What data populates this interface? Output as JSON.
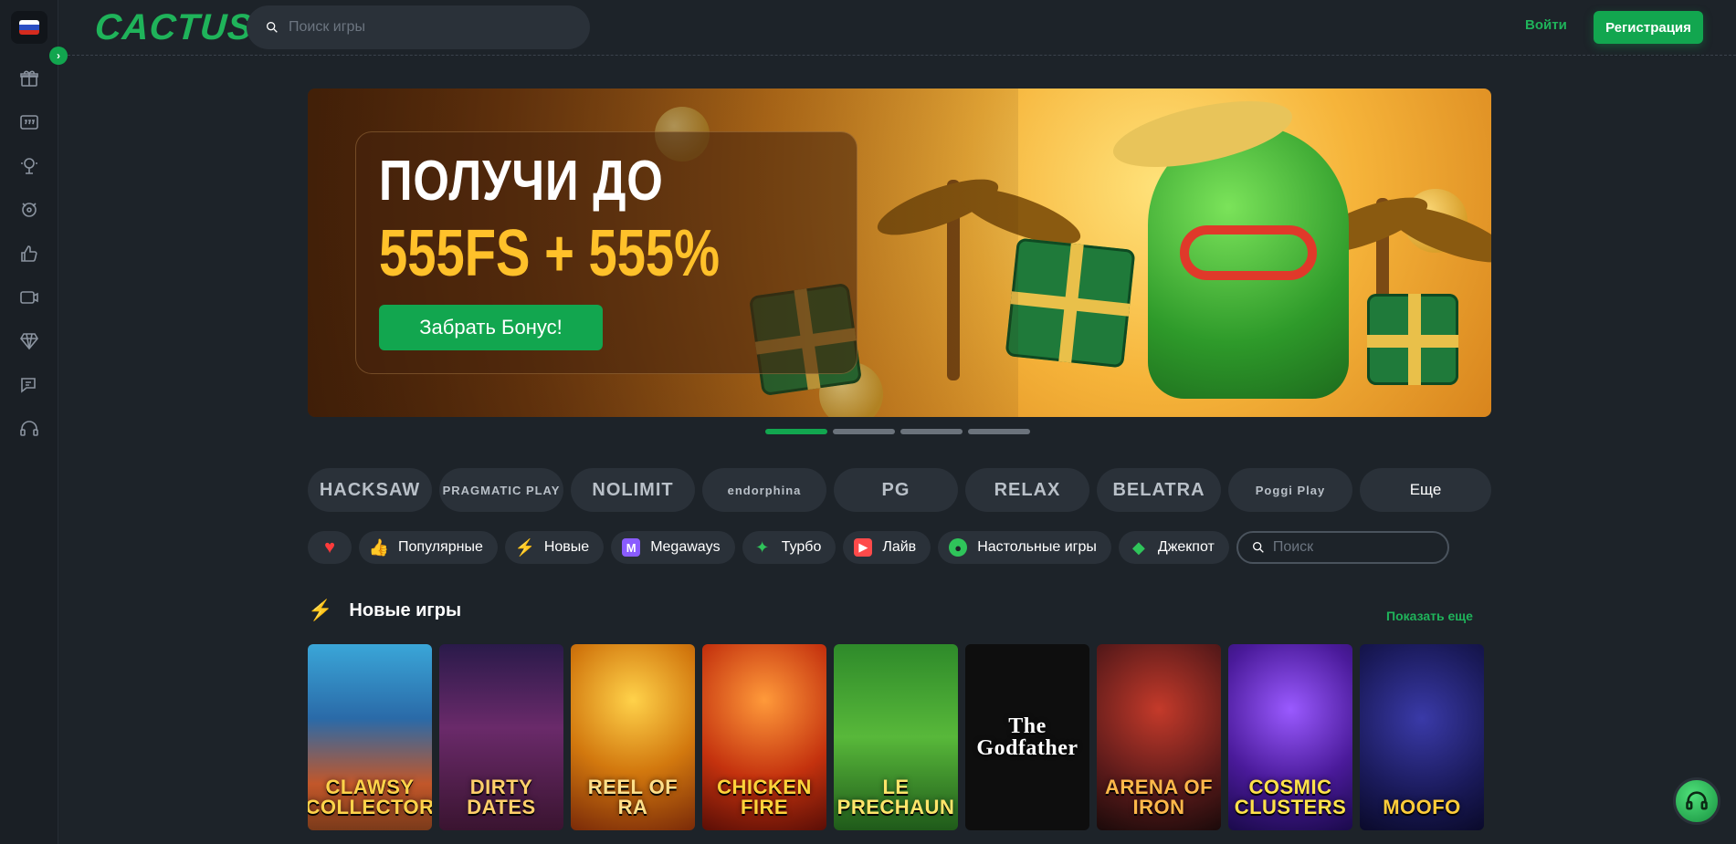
{
  "header": {
    "logo": "CACTUS",
    "search_placeholder": "Поиск игры",
    "login": "Войти",
    "register": "Регистрация"
  },
  "sidebar": {
    "language_flag": "ru-flag",
    "icons": [
      "gift-icon",
      "slots-icon",
      "tournament-icon",
      "games-icon",
      "like-icon",
      "live-icon",
      "diamond-icon",
      "chat-icon",
      "support-icon"
    ]
  },
  "banner": {
    "line1": "ПОЛУЧИ ДО",
    "line2": "555FS + 555%",
    "button": "Забрать Бонус!",
    "slide_count": 4,
    "active_slide": 1
  },
  "providers": {
    "items": [
      "HACKSAW",
      "PRAGMATIC PLAY",
      "NOLIMIT",
      "endorphina",
      "PG",
      "RELAX",
      "BELATRA",
      "Poggi Play"
    ],
    "more": "Еще"
  },
  "categories": {
    "items": [
      {
        "label": "Популярные",
        "icon": "thumbs-up-icon",
        "color": "#f5c518"
      },
      {
        "label": "Новые",
        "icon": "bolt-icon",
        "color": "#c044ff"
      },
      {
        "label": "Megaways",
        "icon": "megaways-icon",
        "color": "#8a5cff"
      },
      {
        "label": "Турбо",
        "icon": "turbo-icon",
        "color": "#2fc45a"
      },
      {
        "label": "Лайв",
        "icon": "live-icon",
        "color": "#ff4a4a"
      },
      {
        "label": "Настольные игры",
        "icon": "table-games-icon",
        "color": "#2fc45a"
      },
      {
        "label": "Джекпот",
        "icon": "jackpot-icon",
        "color": "#2fc45a"
      }
    ],
    "search_placeholder": "Поиск"
  },
  "new_games": {
    "title": "Новые игры",
    "show_more": "Показать еще",
    "games": [
      {
        "title": "CLAWSY COLLECTOR"
      },
      {
        "title": "DIRTY DATES"
      },
      {
        "title": "REEL OF RA"
      },
      {
        "title": "CHICKEN FIRE"
      },
      {
        "title": "LE PRECHAUN"
      },
      {
        "title": "The Godfather"
      },
      {
        "title": "ARENA OF IRON"
      },
      {
        "title": "COSMIC CLUSTERS"
      },
      {
        "title": "MOOFO"
      }
    ]
  },
  "colors": {
    "accent": "#12a64f",
    "background": "#1d2329",
    "panel": "#2a3139"
  }
}
